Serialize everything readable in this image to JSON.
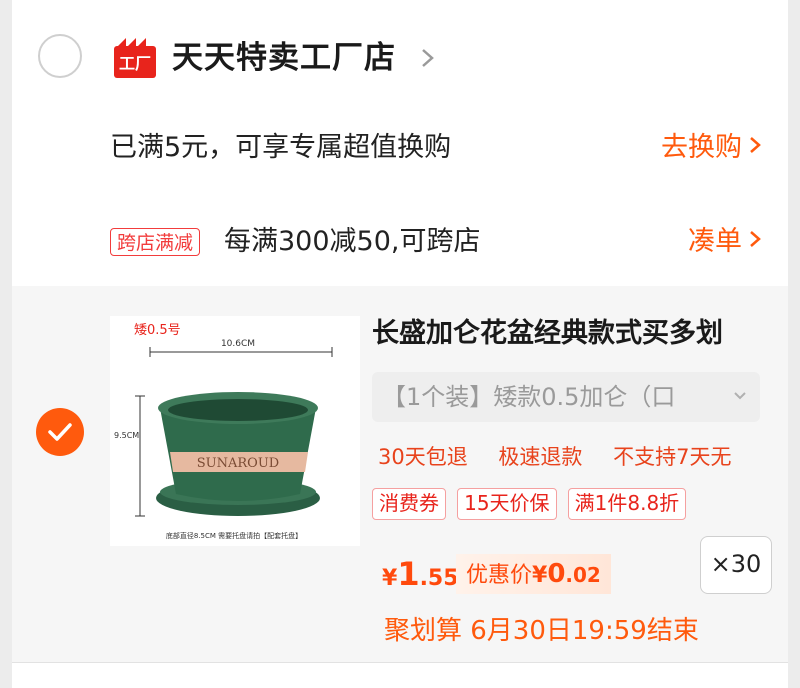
{
  "store": {
    "logo_text": "工厂",
    "name": "天天特卖工厂店"
  },
  "promo": {
    "text": "已满5元，可享专属超值换购",
    "link": "去换购"
  },
  "cross_store": {
    "badge": "跨店满减",
    "text": "每满300减50,可跨店",
    "link": "凑单"
  },
  "product": {
    "image": {
      "label": "矮0.5号",
      "width_label": "10.6CM",
      "height_label": "9.5CM",
      "brand": "SUNAROUD",
      "caption": "底部直径8.5CM  需要托盘请拍【配套托盘】"
    },
    "title": "长盛加仑花盆经典款式买多划",
    "sku": "【1个装】矮款0.5加仑（口",
    "services": [
      "30天包退",
      "极速退款",
      "不支持7天无"
    ],
    "tags": [
      "消费券",
      "15天价保",
      "满1件8.8折"
    ],
    "price": {
      "currency": "¥",
      "integer": "1",
      "decimal": ".55"
    },
    "discount": {
      "label": "优惠价",
      "currency": "¥",
      "integer": "0",
      "decimal": ".02"
    },
    "quantity": "×30",
    "deadline": "聚划算 6月30日19:59结束"
  },
  "colors": {
    "accent": "#ff5a0d",
    "tag_red": "#e8241c",
    "pot_green": "#2f6b4c"
  }
}
